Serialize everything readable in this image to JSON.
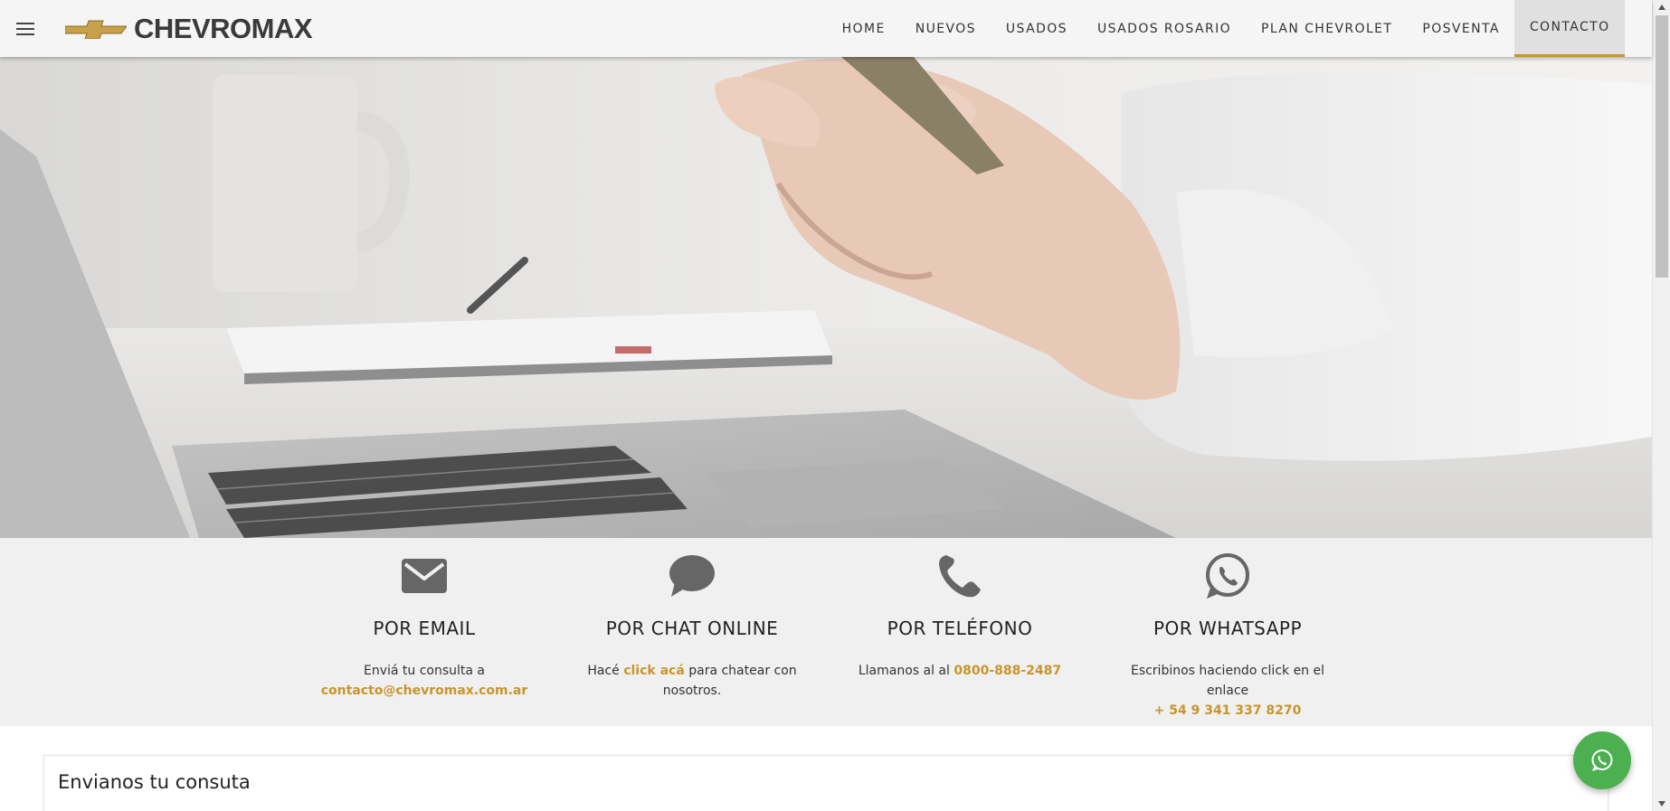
{
  "header": {
    "brand": "CHEVROMAX",
    "nav": [
      "HOME",
      "NUEVOS",
      "USADOS",
      "USADOS ROSARIO",
      "PLAN CHEVROLET",
      "POSVENTA",
      "CONTACTO"
    ],
    "active_nav": "CONTACTO"
  },
  "options": [
    {
      "title": "POR EMAIL",
      "text_before": "Enviá tu consulta a",
      "link": "contacto@chevromax.com.ar",
      "text_after": ""
    },
    {
      "title": "POR CHAT ONLINE",
      "text_before": "Hacé",
      "link": "click acá",
      "text_after": "para chatear con nosotros."
    },
    {
      "title": "POR TELÉFONO",
      "text_before": "Llamanos al al",
      "link": "0800-888-2487",
      "text_after": ""
    },
    {
      "title": "POR WHATSAPP",
      "text_before": "Escribinos haciendo click en el enlace",
      "link": "+ 54 9 341 337 8270",
      "text_after": ""
    }
  ],
  "form": {
    "title": "Envianos tu consuta"
  },
  "colors": {
    "accent": "#c8952c",
    "whatsapp": "#4caf50",
    "band": "#f0f0f0"
  },
  "icons": [
    "menu-icon",
    "chevrolet-bowtie-logo",
    "email-icon",
    "chat-icon",
    "phone-icon",
    "whatsapp-icon"
  ]
}
